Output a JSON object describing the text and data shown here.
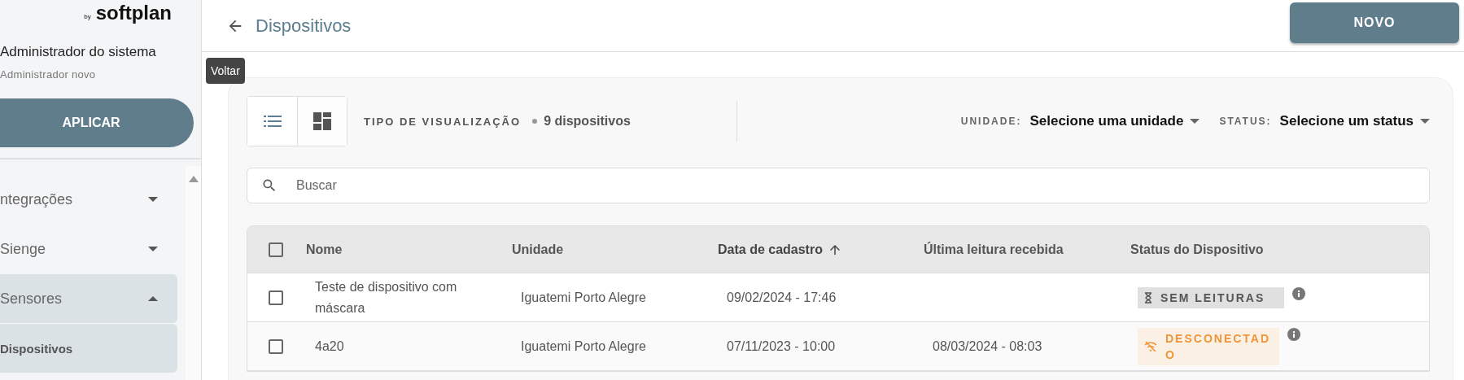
{
  "sidebar": {
    "logo": {
      "prefix": "by",
      "brand": "softplan"
    },
    "user": {
      "name": "Administrador do sistema",
      "role": "Administrador novo"
    },
    "apply_button": "APLICAR",
    "items": [
      {
        "label": "ntegrações",
        "expanded": false,
        "selected": false
      },
      {
        "label": "Sienge",
        "expanded": false,
        "selected": false
      },
      {
        "label": "Sensores",
        "expanded": true,
        "selected": true,
        "children": [
          {
            "label": "Dispositivos",
            "selected": true
          }
        ]
      }
    ]
  },
  "header": {
    "title": "Dispositivos",
    "new_button": "NOVO",
    "tooltip": "Voltar"
  },
  "toolbar": {
    "views": [
      {
        "kind": "list",
        "selected": true
      },
      {
        "kind": "grid",
        "selected": false
      }
    ],
    "view_label": "TIPO DE VISUALIZAÇÃO",
    "count": "9 dispositivos",
    "filters": [
      {
        "label": "UNIDADE:",
        "value": "Selecione uma unidade"
      },
      {
        "label": "STATUS:",
        "value": "Selecione um status"
      }
    ]
  },
  "search": {
    "placeholder": "Buscar"
  },
  "table": {
    "select_all": {
      "checked": false
    },
    "columns": [
      {
        "label": "Nome",
        "sorted": false
      },
      {
        "label": "Unidade",
        "sorted": false
      },
      {
        "label": "Data de cadastro",
        "sorted": true
      },
      {
        "label": "Última leitura recebida",
        "sorted": false
      },
      {
        "label": "Status do Dispositivo",
        "sorted": false
      }
    ],
    "rows": [
      {
        "checked": false,
        "name": "Teste de dispositivo com máscara",
        "unit": "Iguatemi Porto Alegre",
        "created": "09/02/2024 - 17:46",
        "status": {
          "kind": "no_readings",
          "label": "SEM LEITURAS"
        }
      },
      {
        "checked": false,
        "name": "4a20",
        "unit": "Iguatemi Porto Alegre",
        "created": "07/11/2023 - 10:00",
        "last_reading": "08/03/2024 - 08:03",
        "status": {
          "kind": "disconnected",
          "label": "DESCONECTADO"
        }
      }
    ]
  }
}
